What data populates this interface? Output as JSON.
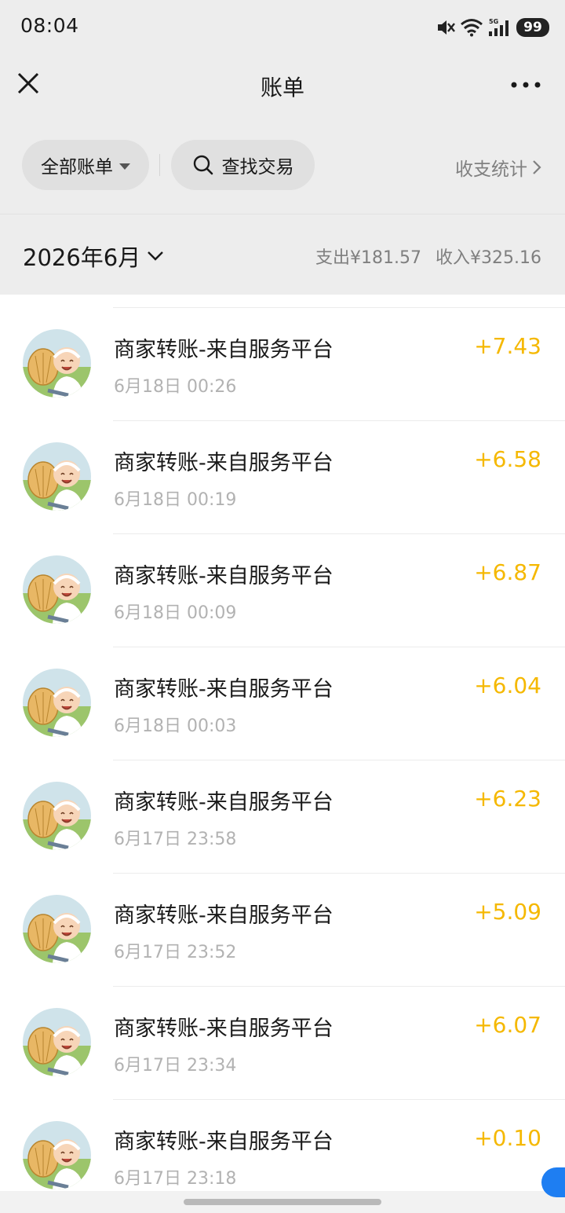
{
  "status_bar": {
    "time": "08:04",
    "battery": "99",
    "network": "5G"
  },
  "nav": {
    "title": "账单"
  },
  "toolbar": {
    "filter_label": "全部账单",
    "search_label": "查找交易",
    "stats_label": "收支统计"
  },
  "summary": {
    "month": "2026年6月",
    "expense_label": "支出",
    "expense_value": "¥181.57",
    "income_label": "收入",
    "income_value": "¥325.16"
  },
  "transactions": [
    {
      "title": "商家转账-来自服务平台",
      "time": "6月18日 00:26",
      "amount": "+7.43"
    },
    {
      "title": "商家转账-来自服务平台",
      "time": "6月18日 00:19",
      "amount": "+6.58"
    },
    {
      "title": "商家转账-来自服务平台",
      "time": "6月18日 00:09",
      "amount": "+6.87"
    },
    {
      "title": "商家转账-来自服务平台",
      "time": "6月18日 00:03",
      "amount": "+6.04"
    },
    {
      "title": "商家转账-来自服务平台",
      "time": "6月17日 23:58",
      "amount": "+6.23"
    },
    {
      "title": "商家转账-来自服务平台",
      "time": "6月17日 23:52",
      "amount": "+5.09"
    },
    {
      "title": "商家转账-来自服务平台",
      "time": "6月17日 23:34",
      "amount": "+6.07"
    },
    {
      "title": "商家转账-来自服务平台",
      "time": "6月17日 23:18",
      "amount": "+0.10"
    }
  ],
  "icons": {
    "close": "close-icon",
    "more": "more-icon",
    "search": "search-icon",
    "chevron": "chevron-right-icon"
  },
  "colors": {
    "amount": "#f5b800",
    "background": "#ededed",
    "list": "#ffffff"
  }
}
